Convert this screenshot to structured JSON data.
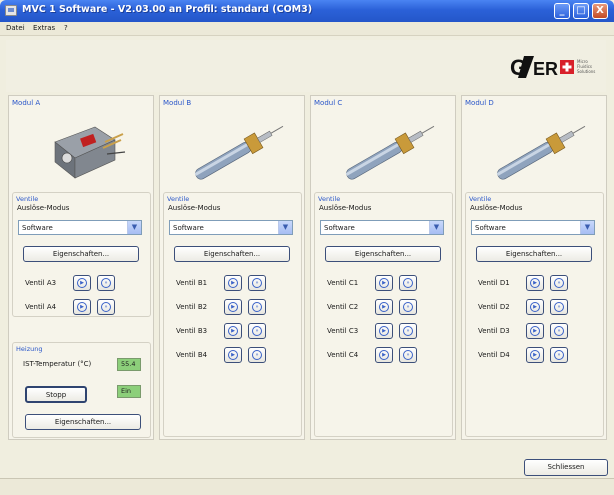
{
  "window": {
    "title": "MVC 1 Software - V2.03.00 an Profil: standard (COM3)",
    "minimize_glyph": "_",
    "maximize_glyph": "□",
    "close_glyph": "X"
  },
  "menu": [
    "Datei",
    "Extras",
    "?"
  ],
  "modules": [
    {
      "title": "Modul A",
      "valves_group": "Ventile",
      "trigger_label": "Auslöse-Modus",
      "trigger_value": "Software",
      "properties_label": "Eigenschaften...",
      "valves": [
        "Ventil A3",
        "Ventil A4"
      ]
    },
    {
      "title": "Modul B",
      "valves_group": "Ventile",
      "trigger_label": "Auslöse-Modus",
      "trigger_value": "Software",
      "properties_label": "Eigenschaften...",
      "valves": [
        "Ventil B1",
        "Ventil B2",
        "Ventil B3",
        "Ventil B4"
      ]
    },
    {
      "title": "Modul C",
      "valves_group": "Ventile",
      "trigger_label": "Auslöse-Modus",
      "trigger_value": "Software",
      "properties_label": "Eigenschaften...",
      "valves": [
        "Ventil C1",
        "Ventil C2",
        "Ventil C3",
        "Ventil C4"
      ]
    },
    {
      "title": "Modul D",
      "valves_group": "Ventile",
      "trigger_label": "Auslöse-Modus",
      "trigger_value": "Software",
      "properties_label": "Eigenschaften...",
      "valves": [
        "Ventil D1",
        "Ventil D2",
        "Ventil D3",
        "Ventil D4"
      ]
    }
  ],
  "heating": {
    "title": "Heizung",
    "temp_label": "IST-Temperatur (°C)",
    "temp_value": "55.4",
    "stop_label": "Stopp",
    "status_value": "Ein",
    "properties_label": "Eigenschaften..."
  },
  "close_label": "Schliessen",
  "logo": {
    "brand_left": "G",
    "brand_right": "ER",
    "tagline": [
      "Micro",
      "Fluidics",
      "Solutions"
    ]
  },
  "icons": {
    "play": "play-circle-icon",
    "fast_forward": "fast-forward-circle-icon",
    "dropdown": "chevron-down-icon"
  },
  "colors": {
    "titlebar": "#2b61d8",
    "group_title": "#2b57c9",
    "display_green": "#8ccf7a",
    "logo_red": "#d8202a"
  }
}
